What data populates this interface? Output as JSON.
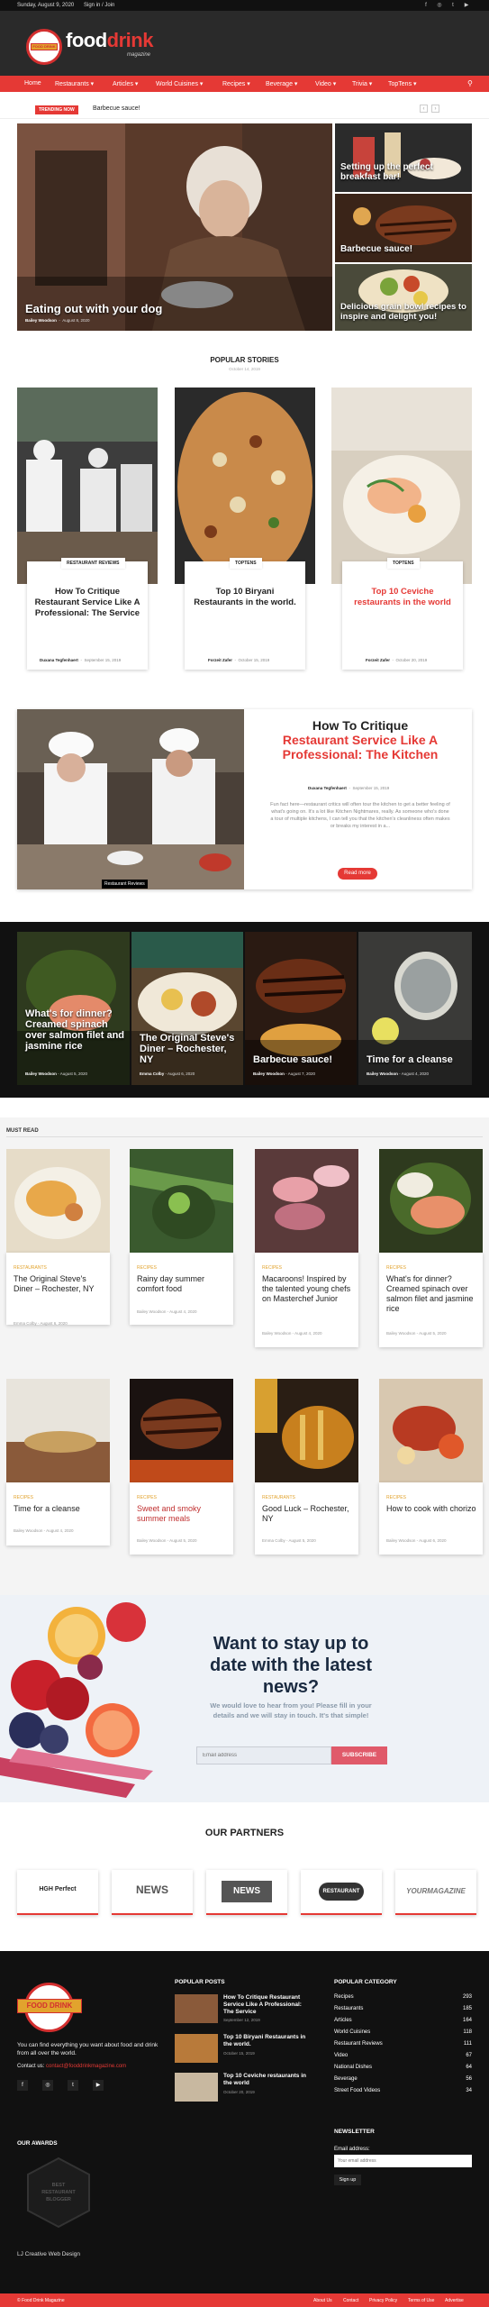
{
  "topbar": {
    "date": "Sunday, August 9, 2020",
    "signin": "Sign in / Join",
    "social": [
      "f",
      "◎",
      "t",
      "▶"
    ]
  },
  "header": {
    "logo_word_a": "food",
    "logo_word_b": "drink",
    "logo_mag": "magazine",
    "logo_badge": "FOOD DRINK"
  },
  "nav": {
    "items": [
      "Home",
      "Restaurants ▾",
      "Articles ▾",
      "World Cuisines ▾",
      "Recipes ▾",
      "Beverage ▾",
      "Video ▾",
      "Trivia ▾",
      "TopTens ▾"
    ],
    "search_icon": "search-icon"
  },
  "trending": {
    "label": "TRENDING NOW",
    "title": "Barbecue sauce!",
    "prev": "‹",
    "next": "›"
  },
  "hero": {
    "main": {
      "title": "Eating out with your dog",
      "author": "Bailey Woodson",
      "date": "August 8, 2020"
    },
    "side": [
      {
        "title": "Setting up the perfect breakfast bar!"
      },
      {
        "title": "Barbecue sauce!"
      },
      {
        "title": "Delicious grain bowl recipes to inspire and delight you!"
      }
    ]
  },
  "popular": {
    "heading": "POPULAR STORIES",
    "sub": "October 14, 2019",
    "cards": [
      {
        "cat": "RESTAURANT REVIEWS",
        "title": "How To Critique Restaurant Service Like A Professional: The Service",
        "author": "Duxana Tegfenhaert",
        "date": "September 15, 2019"
      },
      {
        "cat": "TOPTENS",
        "title": "Top 10 Biryani Restaurants in the world.",
        "author": "Forzeit Zafer",
        "date": "October 15, 2019"
      },
      {
        "cat": "TOPTENS",
        "title": "Top 10 Ceviche restaurants in the world",
        "author": "Forzeit Zafer",
        "date": "October 20, 2019"
      }
    ]
  },
  "feature": {
    "title_a": "How To Critique",
    "title_b": "Restaurant Service Like A Professional: The Kitchen",
    "author": "Duxana Tegfenhaert",
    "date": "September 15, 2019",
    "excerpt": "Fun fact here—restaurant critics will often tour the kitchen to get a better feeling of what's going on. It's a lot like Kitchen Nightmares, really. As someone who's done a tour of multiple kitchens, I can tell you that the kitchen's cleanliness often makes or breaks my interest in a...",
    "button": "Read more",
    "badge": "Restaurant Reviews"
  },
  "gallery": [
    {
      "title": "What's for dinner?Creamed spinach over salmon filet and jasmine rice",
      "author": "Bailey Woodson",
      "date": "August 5, 2020"
    },
    {
      "title": "The Original Steve's Diner – Rochester, NY",
      "author": "Emma Colby",
      "date": "August 6, 2020"
    },
    {
      "title": "Barbecue sauce!",
      "author": "Bailey Woodson",
      "date": "August 7, 2020"
    },
    {
      "title": "Time for a cleanse",
      "author": "Bailey Woodson",
      "date": "August 4, 2020"
    }
  ],
  "mustread": {
    "heading": "MUST READ",
    "items": [
      {
        "cat": "RESTAURANTS",
        "title": "The Original Steve's Diner – Rochester, NY",
        "meta": "Emma Colby  -  August 6, 2020"
      },
      {
        "cat": "RECIPES",
        "title": "Rainy day summer comfort food",
        "meta": "Bailey Woodson  -  August 4, 2020"
      },
      {
        "cat": "RECIPES",
        "title": "Macaroons! Inspired by the talented young chefs on Masterchef Junior",
        "meta": "Bailey Woodson  -  August 4, 2020"
      },
      {
        "cat": "RECIPES",
        "title": "What's for dinner? Creamed spinach over salmon filet and jasmine rice",
        "meta": "Bailey Woodson  -  August 5, 2020"
      },
      {
        "cat": "RECIPES",
        "title": "Time for a cleanse",
        "meta": "Bailey Woodson  -  August 4, 2020"
      },
      {
        "cat": "RECIPES",
        "title": "Sweet and smoky summer meals",
        "meta": "Bailey Woodson  -  August 5, 2020"
      },
      {
        "cat": "RESTAURANTS",
        "title": "Good Luck – Rochester, NY",
        "meta": "Emma Colby  -  August 5, 2020"
      },
      {
        "cat": "RECIPES",
        "title": "How to cook with chorizo",
        "meta": "Bailey Woodson  -  August 6, 2020"
      }
    ]
  },
  "newsletter": {
    "title": "Want to stay up to date with the latest news?",
    "text": "We would love to hear from you! Please fill in your details and we will stay in touch. It's that simple!",
    "placeholder": "Email address",
    "button": "SUBSCRIBE"
  },
  "partners": {
    "heading": "OUR PARTNERS",
    "logos": [
      "HGH Perfect",
      "NEWS",
      "NEWS",
      "RESTAURANT",
      "YOURMAGAZINE"
    ]
  },
  "footer": {
    "about": "You can find everything you want about food and drink from all over the world.",
    "contact_label": "Contact us:",
    "contact_email": "contact@fooddrinkmagazine.com",
    "awards_heading": "OUR AWARDS",
    "award_text": "BEST RESTAURANT BLOGGER",
    "credit": "LJ Creative Web Design",
    "popular_heading": "POPULAR POSTS",
    "posts": [
      {
        "title": "How To Critique Restaurant Service Like A Professional: The Service",
        "date": "September 12, 2019"
      },
      {
        "title": "Top 10 Biryani Restaurants in the world.",
        "date": "October 15, 2019"
      },
      {
        "title": "Top 10 Ceviche restaurants in the world",
        "date": "October 20, 2019"
      }
    ],
    "cat_heading": "POPULAR CATEGORY",
    "categories": [
      {
        "name": "Recipes",
        "count": "293"
      },
      {
        "name": "Restaurants",
        "count": "185"
      },
      {
        "name": "Articles",
        "count": "164"
      },
      {
        "name": "World Cuisines",
        "count": "118"
      },
      {
        "name": "Restaurant Reviews",
        "count": "111"
      },
      {
        "name": "Video",
        "count": "67"
      },
      {
        "name": "National Dishes",
        "count": "64"
      },
      {
        "name": "Beverage",
        "count": "56"
      },
      {
        "name": "Street Food Videos",
        "count": "34"
      }
    ],
    "newsletter_heading": "NEWSLETTER",
    "email_label": "Email address:",
    "email_placeholder": "Your email address",
    "signup": "Sign up"
  },
  "bottom": {
    "copyright": "© Food Drink Magazine",
    "links": [
      "About Us",
      "Contact",
      "Privacy Policy",
      "Terms of Use",
      "Advertise"
    ]
  }
}
